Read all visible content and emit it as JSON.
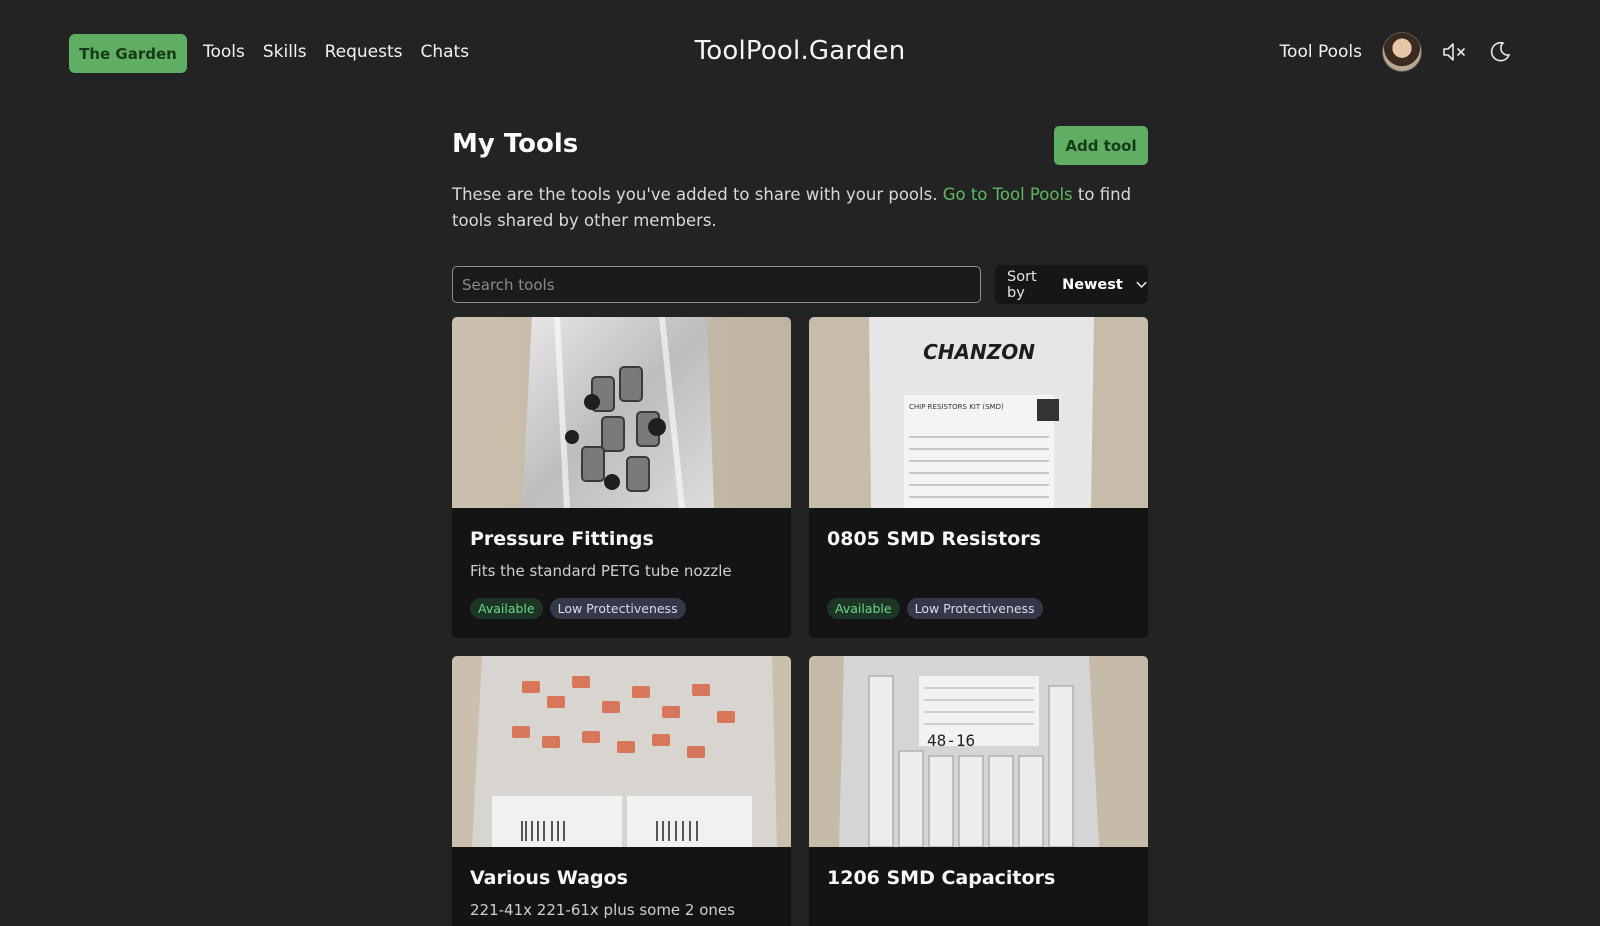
{
  "header": {
    "brand_label": "The Garden",
    "nav": [
      "Tools",
      "Skills",
      "Requests",
      "Chats"
    ],
    "site_title": "ToolPool.Garden",
    "pools_link": "Tool Pools",
    "mute_icon": "volume-muted-icon",
    "theme_icon": "moon-icon"
  },
  "page": {
    "title": "My Tools",
    "add_label": "Add tool",
    "intro_before": "These are the tools you've added to share with your pools.",
    "intro_link": "Go to Tool Pools",
    "intro_after": "to find tools shared by other members.",
    "search_placeholder": "Search tools",
    "sort_prefix": "Sort by",
    "sort_value": "Newest"
  },
  "tools": [
    {
      "name": "Pressure Fittings",
      "desc": "Fits the standard PETG tube nozzle",
      "status": "Available",
      "protect": "Low Protectiveness"
    },
    {
      "name": "0805 SMD Resistors",
      "desc": "",
      "status": "Available",
      "protect": "Low Protectiveness",
      "package_brand": "CHANZON",
      "package_label": "CHIP RESISTORS KIT (SMD)"
    },
    {
      "name": "Various Wagos",
      "desc": "221-41x 221-61x plus some 2 ones"
    },
    {
      "name": "1206 SMD Capacitors",
      "desc": "",
      "package_label": "48-16"
    }
  ],
  "colors": {
    "accent": "#5fae63",
    "background": "#232323",
    "card": "#141414",
    "link": "#5fb864"
  }
}
